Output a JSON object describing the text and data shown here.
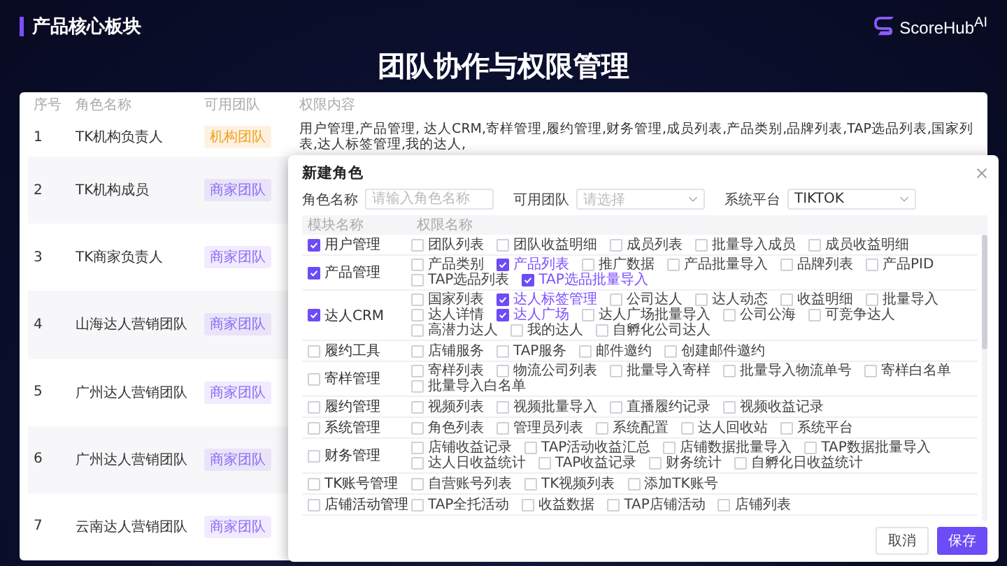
{
  "section_title": "产品核心板块",
  "logo": {
    "text": "ScoreHub$^{AI}$"
  },
  "title": "团队协作与权限管理",
  "roles_table": {
    "columns": [
      "序号",
      "角色名称",
      "可用团队",
      "权限内容"
    ],
    "rows": [
      {
        "index": "1",
        "name": "TK机构负责人",
        "team": "机构团队",
        "color": "#f0a020",
        "permissions": "用户管理,产品管理, 达人CRM,寄样管理,履约管理,财务管理,成员列表,产品类别,品牌列表,TAP选品列表,国家列表,达人标签管理,我的达人,"
      },
      {
        "index": "2",
        "name": "TK机构成员",
        "team": "商家团队",
        "color": "#8b6cf7"
      },
      {
        "index": "3",
        "name": "TK商家负责人",
        "team": "商家团队",
        "color": "#8b6cf7"
      },
      {
        "index": "4",
        "name": "山海达人营销团队",
        "team": "商家团队",
        "color": "#8b6cf7"
      },
      {
        "index": "5",
        "name": "广州达人营销团队",
        "team": "商家团队",
        "color": "#8b6cf7"
      },
      {
        "index": "6",
        "name": "广州达人营销团队",
        "team": "商家团队",
        "color": "#8b6cf7"
      },
      {
        "index": "7",
        "name": "云南达人营销团队",
        "team": "商家团队",
        "color": "#8b6cf7"
      }
    ]
  },
  "dialog": {
    "title": "新建角色",
    "fields": [
      {
        "kind": "input",
        "label": "角色名称",
        "placeholder": "请输入角色名称"
      },
      {
        "kind": "select",
        "label": "可用团队",
        "placeholder": "请选择"
      },
      {
        "kind": "select",
        "label": "系统平台",
        "value": "TIKTOK"
      }
    ],
    "columns": [
      "模块名称",
      "权限名称"
    ],
    "modules": [
      {
        "name": "用户管理",
        "checked": true,
        "permissions": [
          {
            "label": "团队列表",
            "checked": false
          },
          {
            "label": "团队收益明细",
            "checked": false
          },
          {
            "label": "成员列表",
            "checked": false
          },
          {
            "label": "批量导入成员",
            "checked": false
          },
          {
            "label": "成员收益明细",
            "checked": false
          }
        ]
      },
      {
        "name": "产品管理",
        "checked": true,
        "permissions": [
          {
            "label": "产品类别",
            "checked": false
          },
          {
            "label": "产品列表",
            "checked": true
          },
          {
            "label": "推广数据",
            "checked": false
          },
          {
            "label": "产品批量导入",
            "checked": false
          },
          {
            "label": "品牌列表",
            "checked": false
          },
          {
            "label": "产品PID",
            "checked": false
          },
          {
            "label": "TAP选品列表",
            "checked": false
          },
          {
            "label": "TAP选品批量导入",
            "checked": true
          }
        ]
      },
      {
        "name": "达人CRM",
        "checked": true,
        "permissions": [
          {
            "label": "国家列表",
            "checked": false
          },
          {
            "label": "达人标签管理",
            "checked": true
          },
          {
            "label": "公司达人",
            "checked": false
          },
          {
            "label": "达人动态",
            "checked": false
          },
          {
            "label": "收益明细",
            "checked": false
          },
          {
            "label": "批量导入",
            "checked": false
          },
          {
            "label": "达人详情",
            "checked": false
          },
          {
            "label": "达人广场",
            "checked": true
          },
          {
            "label": "达人广场批量导入",
            "checked": false
          },
          {
            "label": "公司公海",
            "checked": false
          },
          {
            "label": "可竞争达人",
            "checked": false
          },
          {
            "label": "高潜力达人",
            "checked": false
          },
          {
            "label": "我的达人",
            "checked": false
          },
          {
            "label": "自孵化公司达人",
            "checked": false
          }
        ]
      },
      {
        "name": "履约工具",
        "checked": false,
        "permissions": [
          {
            "label": "店铺服务",
            "checked": false
          },
          {
            "label": "TAP服务",
            "checked": false
          },
          {
            "label": "邮件邀约",
            "checked": false
          },
          {
            "label": "创建邮件邀约",
            "checked": false
          }
        ]
      },
      {
        "name": "寄样管理",
        "checked": false,
        "permissions": [
          {
            "label": "寄样列表",
            "checked": false
          },
          {
            "label": "物流公司列表",
            "checked": false
          },
          {
            "label": "批量导入寄样",
            "checked": false
          },
          {
            "label": "批量导入物流单号",
            "checked": false
          },
          {
            "label": "寄样白名单",
            "checked": false
          },
          {
            "label": "批量导入白名单",
            "checked": false
          }
        ]
      },
      {
        "name": "履约管理",
        "checked": false,
        "permissions": [
          {
            "label": "视频列表",
            "checked": false
          },
          {
            "label": "视频批量导入",
            "checked": false
          },
          {
            "label": "直播履约记录",
            "checked": false
          },
          {
            "label": "视频收益记录",
            "checked": false
          }
        ]
      },
      {
        "name": "系统管理",
        "checked": false,
        "permissions": [
          {
            "label": "角色列表",
            "checked": false
          },
          {
            "label": "管理员列表",
            "checked": false
          },
          {
            "label": "系统配置",
            "checked": false
          },
          {
            "label": "达人回收站",
            "checked": false
          },
          {
            "label": "系统平台",
            "checked": false
          }
        ]
      },
      {
        "name": "财务管理",
        "checked": false,
        "permissions": [
          {
            "label": "店铺收益记录",
            "checked": false
          },
          {
            "label": "TAP活动收益汇总",
            "checked": false
          },
          {
            "label": "店铺数据批量导入",
            "checked": false
          },
          {
            "label": "TAP数据批量导入",
            "checked": false
          },
          {
            "label": "达人日收益统计",
            "checked": false
          },
          {
            "label": "TAP收益记录",
            "checked": false
          },
          {
            "label": "财务统计",
            "checked": false
          },
          {
            "label": "自孵化日收益统计",
            "checked": false
          }
        ]
      },
      {
        "name": "TK账号管理",
        "checked": false,
        "permissions": [
          {
            "label": "自营账号列表",
            "checked": false
          },
          {
            "label": "TK视频列表",
            "checked": false
          },
          {
            "label": "添加TK账号",
            "checked": false
          }
        ]
      },
      {
        "name": "店铺活动管理",
        "checked": false,
        "permissions": [
          {
            "label": "TAP全托活动",
            "checked": false
          },
          {
            "label": "收益数据",
            "checked": false
          },
          {
            "label": "TAP店铺活动",
            "checked": false
          },
          {
            "label": "店铺列表",
            "checked": false
          }
        ]
      }
    ],
    "buttons": [
      {
        "kind": "secondary",
        "label": "取消"
      },
      {
        "kind": "primary",
        "label": "保存"
      }
    ]
  }
}
